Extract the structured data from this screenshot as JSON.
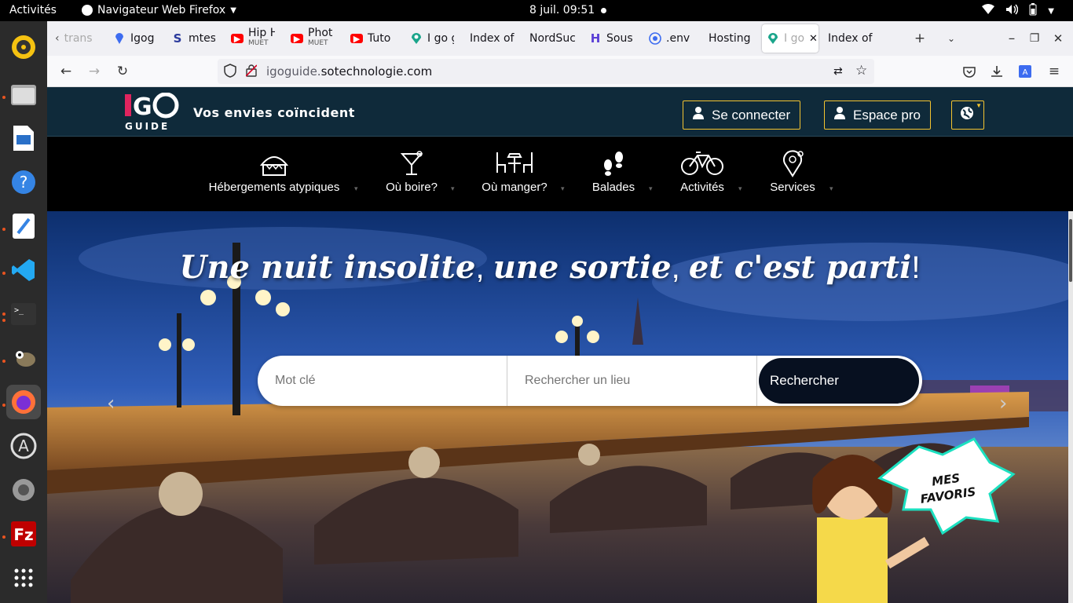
{
  "system": {
    "activities": "Activités",
    "app_menu": "Navigateur Web Firefox",
    "clock": "8 juil.  09:51"
  },
  "tabs": [
    {
      "label": "trans",
      "icon": "chevron-left-icon"
    },
    {
      "label": "Igog",
      "icon": "map-pin-icon"
    },
    {
      "label": "mtes",
      "icon": "s-logo-icon"
    },
    {
      "label": "Hip H",
      "sub": "MUET",
      "icon": "youtube-icon"
    },
    {
      "label": "Phot",
      "sub": "MUET",
      "icon": "youtube-icon"
    },
    {
      "label": "Tuto",
      "icon": "youtube-icon"
    },
    {
      "label": "I go g",
      "icon": "igo-icon"
    },
    {
      "label": "Index of"
    },
    {
      "label": "NordSuc"
    },
    {
      "label": "Sous",
      "icon": "h-logo-icon"
    },
    {
      "label": ".env",
      "icon": "globe-icon"
    },
    {
      "label": "Hosting"
    },
    {
      "label": "I go",
      "icon": "igo-icon"
    },
    {
      "label": "Index of"
    }
  ],
  "url": {
    "domain": "igoguide.",
    "host": "sotechnologie.com"
  },
  "site": {
    "logo_text": "IGO",
    "logo_sub": "GUIDE",
    "tagline": "Vos envies coïncident",
    "login_label": "Se connecter",
    "pro_label": "Espace pro"
  },
  "menu": [
    {
      "label": "Hébergements atypiques",
      "icon": "cabin-icon"
    },
    {
      "label": "Où boire?",
      "icon": "cocktail-icon"
    },
    {
      "label": "Où manger?",
      "icon": "dining-table-icon"
    },
    {
      "label": "Balades",
      "icon": "footprints-icon"
    },
    {
      "label": "Activités",
      "icon": "bicycle-icon"
    },
    {
      "label": "Services",
      "icon": "service-pin-icon"
    }
  ],
  "hero": {
    "title_a": "Une nuit insolite",
    "sep1": ", ",
    "title_b": "une sortie",
    "sep2": ", ",
    "title_c": "et c'est parti",
    "end": "!",
    "keyword_placeholder": "Mot clé",
    "place_placeholder": "Rechercher un lieu",
    "search_label": "Rechercher",
    "favorites_label": "MES FAVORIS"
  },
  "colors": {
    "header_bg": "#0f2a3a",
    "accent": "#f4c430",
    "search_btn": "#071020"
  }
}
